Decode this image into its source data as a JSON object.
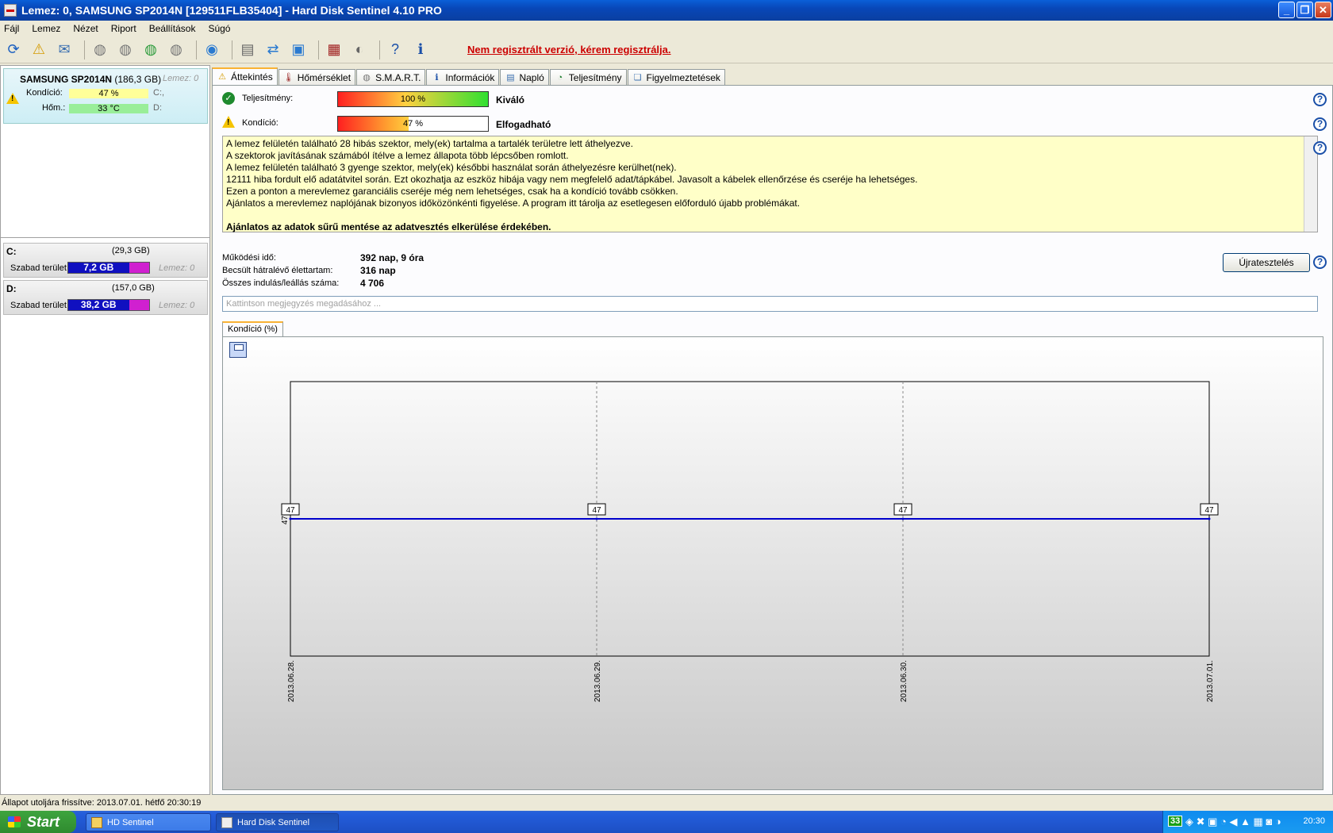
{
  "window": {
    "title": "Lemez: 0, SAMSUNG SP2014N [129511FLB35404]  -  Hard Disk Sentinel 4.10 PRO"
  },
  "menu": [
    "Fájl",
    "Lemez",
    "Nézet",
    "Riport",
    "Beállítások",
    "Súgó"
  ],
  "toolbar": {
    "unregistered": "Nem regisztrált verzió, kérem regisztrálja."
  },
  "disk": {
    "name": "SAMSUNG SP2014N",
    "size": "(186,3 GB)",
    "disk_label": "Lemez: 0",
    "condition_label": "Kondíció:",
    "condition_value": "47 %",
    "condition_percent": 47,
    "temp_label": "Hőm.:",
    "temp_value": "33 °C",
    "drive1": "C:,",
    "drive2": "D:"
  },
  "partitions": [
    {
      "label": "C:",
      "size": "(29,3 GB)",
      "free_label": "Szabad terület",
      "free": "7,2 GB",
      "free_fraction": 0.75,
      "disk": "Lemez: 0"
    },
    {
      "label": "D:",
      "size": "(157,0 GB)",
      "free_label": "Szabad terület",
      "free": "38,2 GB",
      "free_fraction": 0.75,
      "disk": "Lemez: 0"
    }
  ],
  "tabs": [
    "Áttekintés",
    "Hőmérséklet",
    "S.M.A.R.T.",
    "Információk",
    "Napló",
    "Teljesítmény",
    "Figyelmeztetések"
  ],
  "overview": {
    "performance_label": "Teljesítmény:",
    "performance_value": "100 %",
    "performance_percent": 100,
    "performance_result": "Kiváló",
    "condition_label": "Kondíció:",
    "condition_value": "47 %",
    "condition_percent": 47,
    "condition_result": "Elfogadható",
    "messages": [
      "A lemez felületén található 28 hibás szektor, mely(ek) tartalma a tartalék területre lett áthelyezve.",
      "A szektorok javításának számából ítélve a lemez állapota több lépcsőben romlott.",
      "A lemez felületén található 3 gyenge szektor, mely(ek) későbbi használat során áthelyezésre kerülhet(nek).",
      "12111 hiba fordult elő adatátvitel során. Ezt okozhatja az eszköz hibája vagy nem megfelelő adat/tápkábel. Javasolt a kábelek ellenőrzése és cseréje ha lehetséges.",
      "Ezen a ponton a merevlemez garanciális cseréje még nem lehetséges, csak ha a kondíció tovább csökken.",
      "Ajánlatos a merevlemez naplójának bizonyos időközönkénti figyelése. A program itt tárolja az esetlegesen előforduló újabb problémákat."
    ],
    "advice": "Ajánlatos az adatok sűrű mentése az adatvesztés elkerülése érdekében.",
    "uptime_label": "Működési idő:",
    "uptime_value": "392 nap, 9 óra",
    "remaining_label": "Becsült hátralévő élettartam:",
    "remaining_value": "316 nap",
    "starts_label": "Összes indulás/leállás száma:",
    "starts_value": "4 706",
    "retest_button": "Újratesztelés",
    "note_placeholder": "Kattintson megjegyzés megadásához ...",
    "chart_tab": "Kondíció  (%)"
  },
  "chart_data": {
    "type": "line",
    "x": [
      "2013.06.28.",
      "2013.06.29.",
      "2013.06.30.",
      "2013.07.01."
    ],
    "series": [
      {
        "values": [
          47,
          47,
          47,
          47
        ],
        "color": "#0000CC"
      }
    ],
    "ytick": "47",
    "data_labels": [
      "47",
      "47",
      "47",
      "47"
    ]
  },
  "statusbar": {
    "text": "Állapot utoljára frissítve: 2013.07.01. hétfő 20:30:19"
  },
  "taskbar": {
    "start": "Start",
    "tasks": [
      "HD Sentinel",
      "Hard Disk Sentinel"
    ],
    "tray_badge": "33",
    "clock": "20:30"
  }
}
